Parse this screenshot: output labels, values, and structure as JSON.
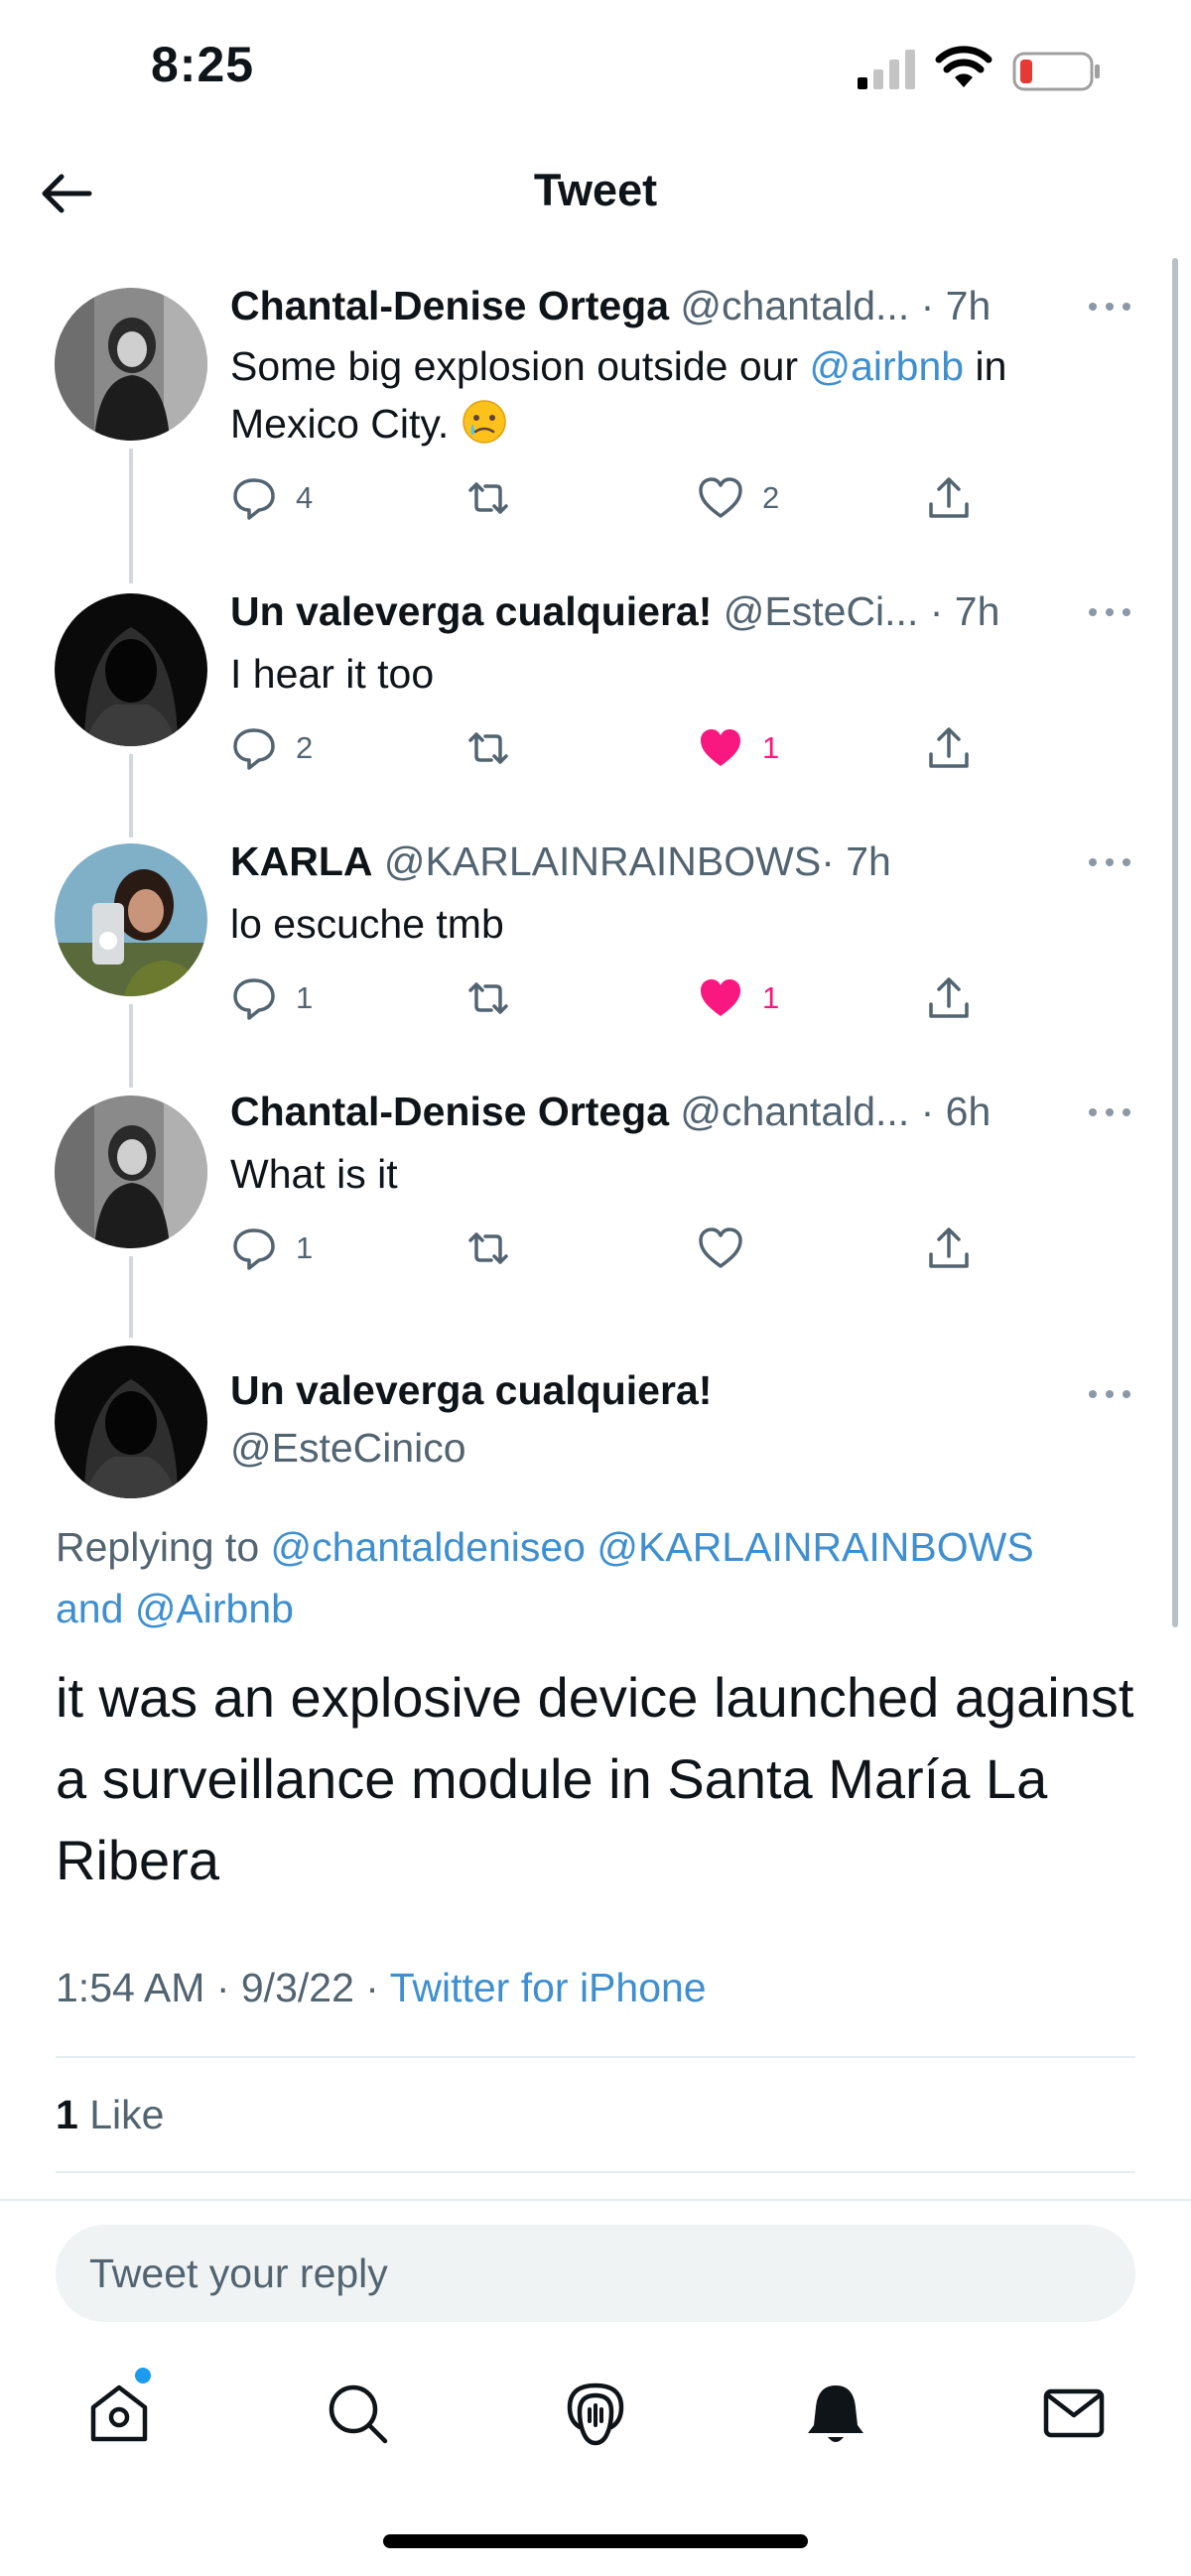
{
  "status_bar": {
    "time": "8:25"
  },
  "header": {
    "title": "Tweet"
  },
  "thread": [
    {
      "name": "Chantal-Denise Ortega",
      "handle": "@chantald...",
      "time": "· 7h",
      "text_prefix": "Some big explosion outside our ",
      "mention": "@airbnb",
      "text_suffix": " in",
      "text_line2": "Mexico City.",
      "emoji": "sad-tear-emoji",
      "replies": "4",
      "likes": "2",
      "liked": false
    },
    {
      "name": "Un valeverga cualquiera!",
      "handle": "@EsteCi...",
      "time": "· 7h",
      "text": "I hear it too",
      "replies": "2",
      "likes": "1",
      "liked": true
    },
    {
      "name": "KARLA",
      "handle": "@KARLAINRAINBOWS",
      "time": "· 7h",
      "text": "lo escuche tmb",
      "replies": "1",
      "likes": "1",
      "liked": true
    },
    {
      "name": "Chantal-Denise Ortega",
      "handle": "@chantald...",
      "time": "· 6h",
      "text": "What is it",
      "replies": "1",
      "likes": "",
      "liked": false
    }
  ],
  "main_tweet": {
    "name": "Un valeverga cualquiera!",
    "handle": "@EsteCinico",
    "replying_label": "Replying to ",
    "replying_mention1": "@chantaldeniseo",
    "replying_mention2": "@KARLAINRAINBOWS",
    "replying_and": "and ",
    "replying_mention3": "@Airbnb",
    "text": "it was an explosive device launched against a surveillance module in Santa María La Ribera",
    "time": "1:54 AM",
    "date": "9/3/22",
    "source": "Twitter for iPhone",
    "like_count": "1",
    "like_label": "Like"
  },
  "reply_box": {
    "placeholder": "Tweet your reply"
  },
  "tab_bar": [
    "home-icon",
    "search-icon",
    "spaces-icon",
    "notifications-icon",
    "messages-icon"
  ],
  "colors": {
    "link": "#3f8fd0",
    "like": "#f91880",
    "muted": "#536471"
  }
}
